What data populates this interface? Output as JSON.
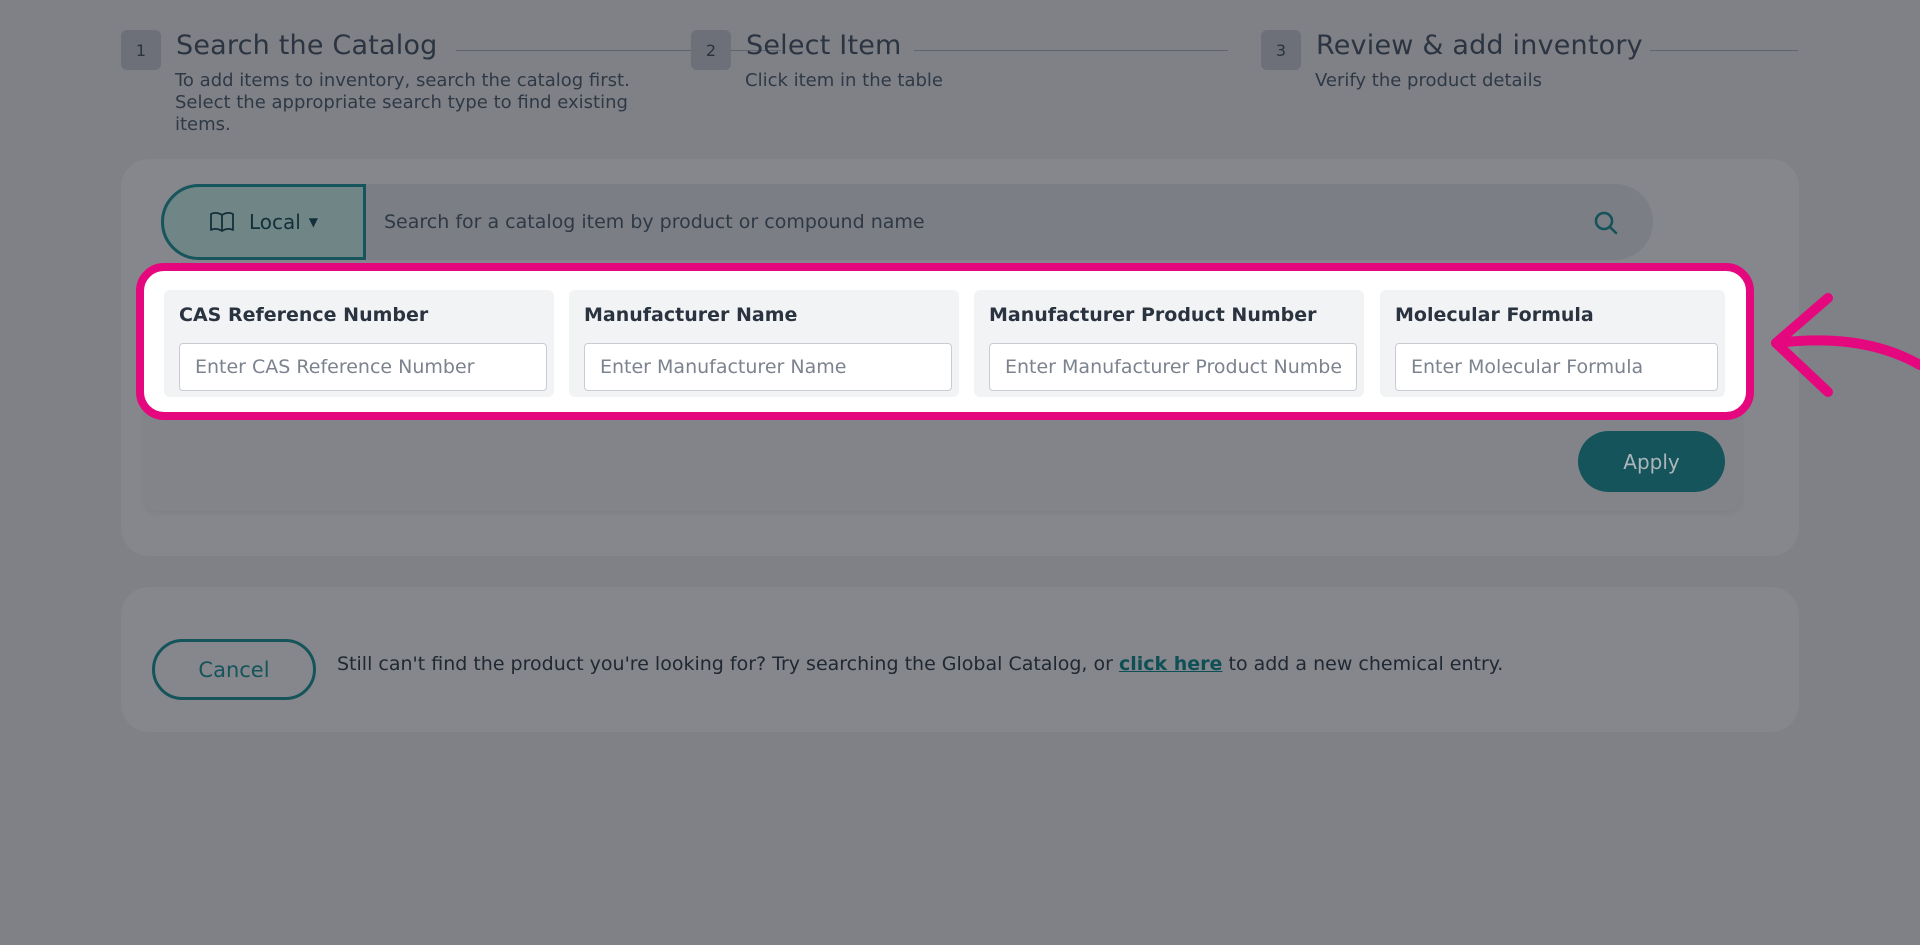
{
  "steps": [
    {
      "number": "1",
      "title": "Search the Catalog",
      "description": "To add items to inventory, search the catalog first. Select the appropriate search type to find existing items."
    },
    {
      "number": "2",
      "title": "Select Item",
      "description": "Click item in the table"
    },
    {
      "number": "3",
      "title": "Review & add inventory",
      "description": "Verify the product details"
    }
  ],
  "search": {
    "scope_label": "Local",
    "placeholder": "Search for a catalog item by product or compound name"
  },
  "filters": [
    {
      "label": "CAS Reference Number",
      "placeholder": "Enter CAS Reference Number"
    },
    {
      "label": "Manufacturer Name",
      "placeholder": "Enter Manufacturer Name"
    },
    {
      "label": "Manufacturer Product Number",
      "placeholder": "Enter Manufacturer Product Number"
    },
    {
      "label": "Molecular Formula",
      "placeholder": "Enter Molecular Formula"
    }
  ],
  "apply_label": "Apply",
  "footer": {
    "cancel_label": "Cancel",
    "text_before": "Still can't find the product you're looking for? Try searching the Global Catalog, or ",
    "link_text": "click here",
    "text_after": " to add a new chemical entry."
  },
  "colors": {
    "highlight": "#e5077d",
    "accent": "#15545a",
    "overlay": "#7f8187"
  }
}
